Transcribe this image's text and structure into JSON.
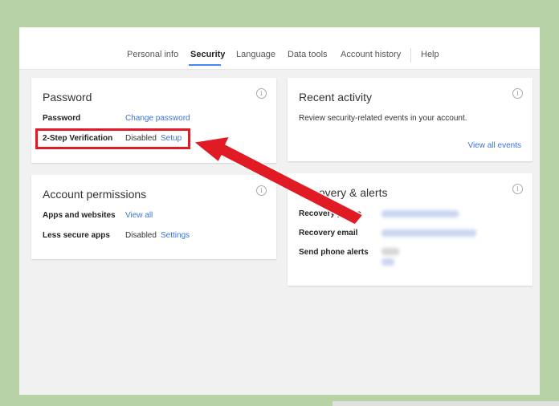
{
  "nav": {
    "items": [
      {
        "label": "Personal info",
        "active": false
      },
      {
        "label": "Security",
        "active": true
      },
      {
        "label": "Language",
        "active": false
      },
      {
        "label": "Data tools",
        "active": false
      },
      {
        "label": "Account history",
        "active": false
      },
      {
        "label": "Help",
        "active": false
      }
    ]
  },
  "password_card": {
    "title": "Password",
    "password_label": "Password",
    "change_password_link": "Change password",
    "two_step_label": "2-Step Verification",
    "two_step_status": "Disabled",
    "two_step_setup_link": "Setup"
  },
  "permissions_card": {
    "title": "Account permissions",
    "apps_label": "Apps and websites",
    "apps_link": "View all",
    "less_secure_label": "Less secure apps",
    "less_secure_status": "Disabled",
    "less_secure_link": "Settings"
  },
  "recent_activity_card": {
    "title": "Recent activity",
    "description": "Review security-related events in your account.",
    "view_all_link": "View all events"
  },
  "recovery_card": {
    "title": "Recovery & alerts",
    "phone_label": "Recovery phone",
    "email_label": "Recovery email",
    "alerts_label": "Send phone alerts"
  },
  "colors": {
    "accent": "#4285f4",
    "link": "#3b73d6",
    "annotation": "#e01b24",
    "frame": "#b7d3a6"
  },
  "icons": {
    "info": "info-icon"
  }
}
